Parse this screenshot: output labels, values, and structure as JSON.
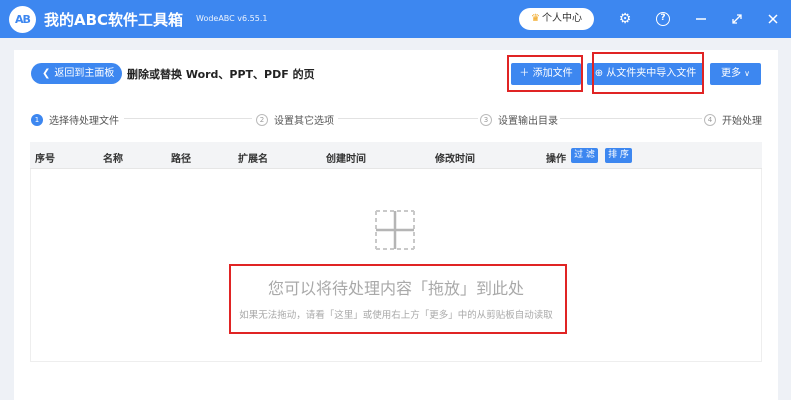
{
  "titlebar": {
    "logo_text": "AB",
    "app_title": "我的ABC软件工具箱",
    "version": "WodeABC v6.55.1",
    "user_center": "个人中心",
    "icons": [
      "settings-icon",
      "help-icon",
      "minimize-icon",
      "maximize-icon",
      "close-icon"
    ]
  },
  "header": {
    "back_label": "返回到主面板",
    "page_title": "删除或替换 Word、PPT、PDF 的页",
    "add_file": "添加文件",
    "import_folder": "从文件夹中导入文件",
    "more": "更多"
  },
  "steps": [
    {
      "num": "1",
      "label": "选择待处理文件"
    },
    {
      "num": "2",
      "label": "设置其它选项"
    },
    {
      "num": "3",
      "label": "设置输出目录"
    },
    {
      "num": "4",
      "label": "开始处理"
    }
  ],
  "table": {
    "columns": [
      "序号",
      "名称",
      "路径",
      "扩展名",
      "创建时间",
      "修改时间",
      "操作"
    ],
    "filter_btn": "过 滤",
    "sort_btn": "排 序"
  },
  "dropzone": {
    "main_text": "您可以将待处理内容「拖放」到此处",
    "sub_text": "如果无法拖动，请看「这里」或使用右上方「更多」中的从剪贴板自动读取"
  },
  "colors": {
    "accent": "#3d87f0",
    "highlight": "#e02424",
    "placeholder_text": "#a9a9a9"
  }
}
